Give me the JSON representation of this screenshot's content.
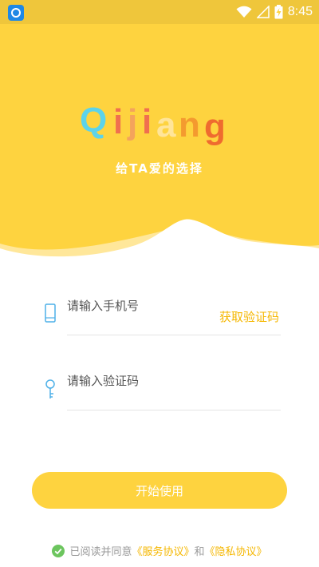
{
  "status_bar": {
    "time": "8:45",
    "icons": [
      "app-icon",
      "wifi-icon",
      "signal-icon",
      "battery-charging-icon"
    ]
  },
  "brand": {
    "logo_text": "Qijiang",
    "tagline": "给TA爱的选择"
  },
  "login": {
    "phone_placeholder": "请输入手机号",
    "get_code_label": "获取验证码",
    "code_placeholder": "请输入验证码",
    "start_button": "开始使用"
  },
  "agreement": {
    "prefix": "已阅读并同意",
    "service_terms": "《服务协议》",
    "conjunction": "和",
    "privacy_terms": "《隐私协议》"
  },
  "colors": {
    "primary_yellow": "#FED33F",
    "link_yellow": "#F5B700",
    "icon_blue": "#4FB1E8",
    "check_green": "#6CC55E"
  }
}
